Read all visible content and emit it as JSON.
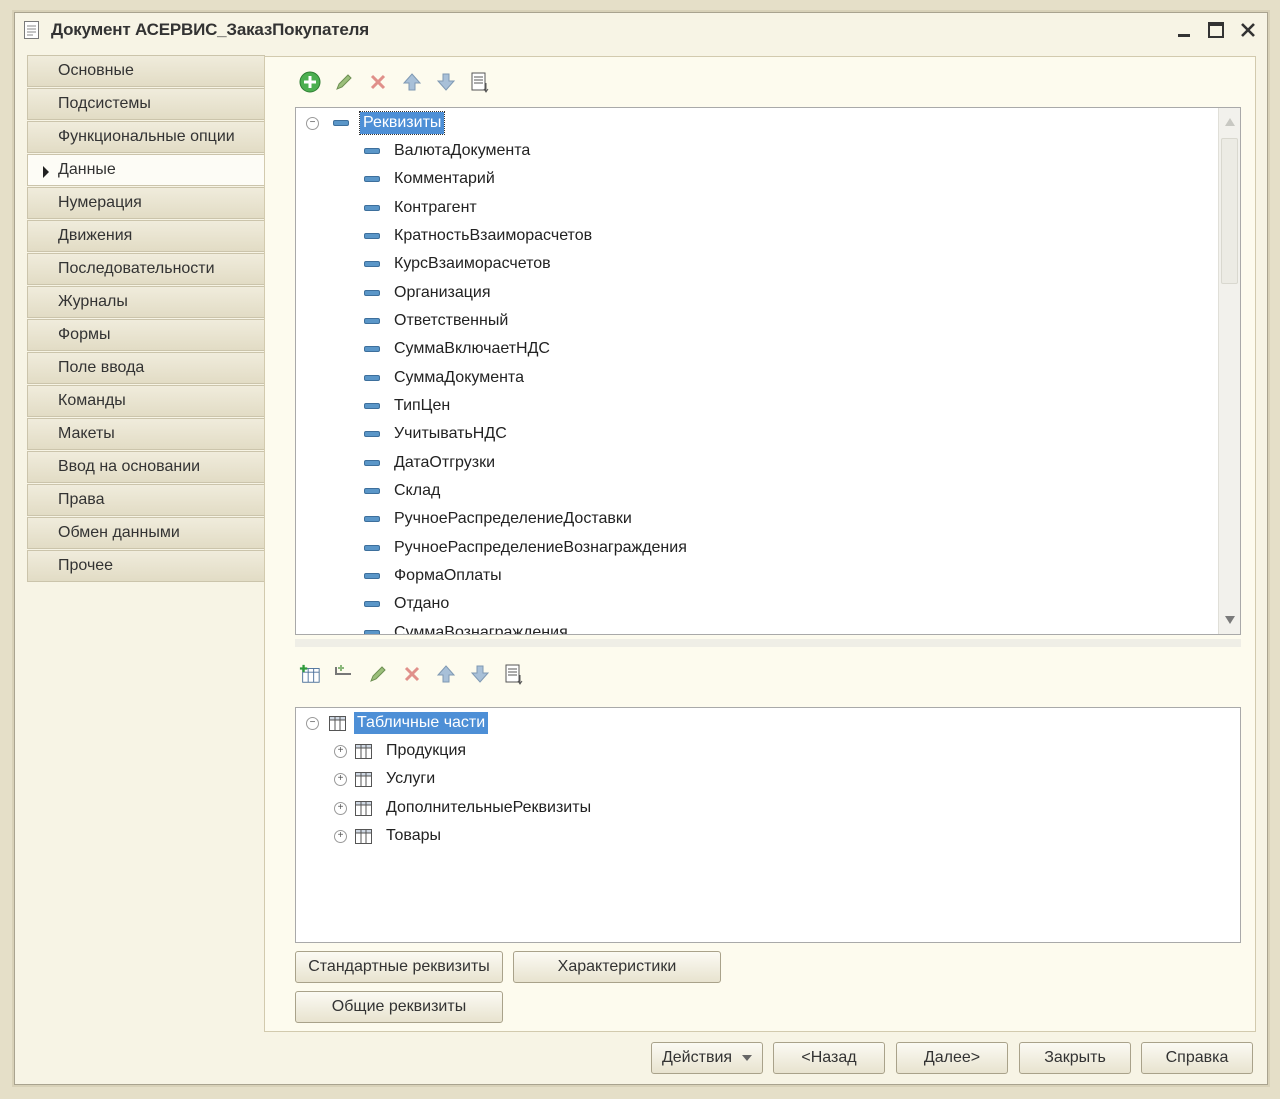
{
  "window": {
    "title": "Документ АСЕРВИС_ЗаказПокупателя"
  },
  "tabs": [
    {
      "label": "Основные",
      "active": false
    },
    {
      "label": "Подсистемы",
      "active": false
    },
    {
      "label": "Функциональные опции",
      "active": false
    },
    {
      "label": "Данные",
      "active": true
    },
    {
      "label": "Нумерация",
      "active": false
    },
    {
      "label": "Движения",
      "active": false
    },
    {
      "label": "Последовательности",
      "active": false
    },
    {
      "label": "Журналы",
      "active": false
    },
    {
      "label": "Формы",
      "active": false
    },
    {
      "label": "Поле ввода",
      "active": false
    },
    {
      "label": "Команды",
      "active": false
    },
    {
      "label": "Макеты",
      "active": false
    },
    {
      "label": "Ввод на основании",
      "active": false
    },
    {
      "label": "Права",
      "active": false
    },
    {
      "label": "Обмен данными",
      "active": false
    },
    {
      "label": "Прочее",
      "active": false
    }
  ],
  "attributes": {
    "root_label": "Реквизиты",
    "items": [
      "ВалютаДокумента",
      "Комментарий",
      "Контрагент",
      "КратностьВзаиморасчетов",
      "КурсВзаиморасчетов",
      "Организация",
      "Ответственный",
      "СуммаВключаетНДС",
      "СуммаДокумента",
      "ТипЦен",
      "УчитыватьНДС",
      "ДатаОтгрузки",
      "Склад",
      "РучноеРаспределениеДоставки",
      "РучноеРаспределениеВознаграждения",
      "ФормаОплаты",
      "Отдано",
      "СуммаВознаграждения"
    ]
  },
  "tabular_sections": {
    "root_label": "Табличные части",
    "items": [
      "Продукция",
      "Услуги",
      "ДополнительныеРеквизиты",
      "Товары"
    ]
  },
  "buttons": {
    "standard_attributes": "Стандартные реквизиты",
    "characteristics": "Характеристики",
    "common_attributes": "Общие реквизиты"
  },
  "footer": {
    "actions": "Действия",
    "back": "<Назад",
    "next": "Далее>",
    "close": "Закрыть",
    "help": "Справка"
  }
}
